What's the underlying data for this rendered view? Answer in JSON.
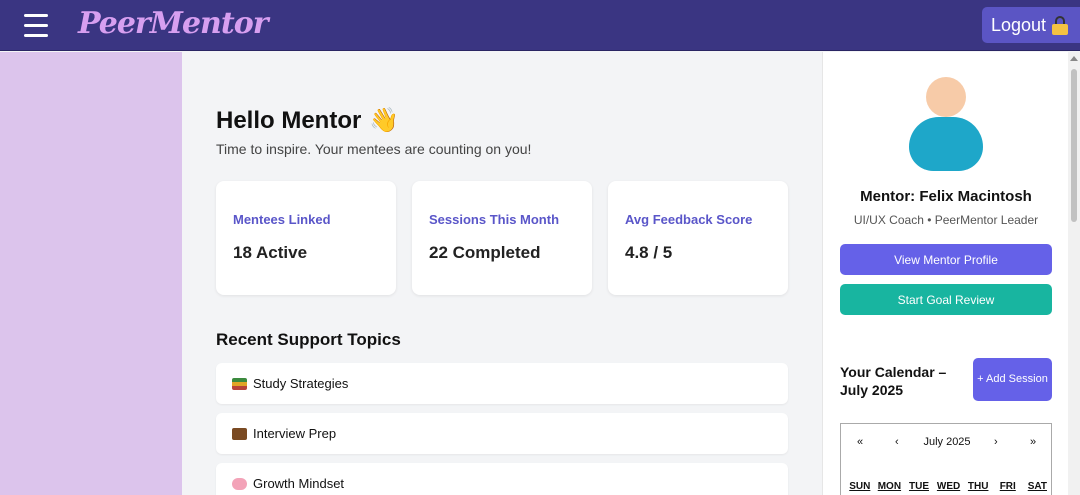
{
  "nav": {
    "brand": "PeerMentor",
    "logout_label": "Logout"
  },
  "main": {
    "greeting": "Hello Mentor",
    "greeting_emoji": "👋",
    "subtitle": "Time to inspire. Your mentees are counting on you!",
    "stats": [
      {
        "label": "Mentees Linked",
        "value": "18 Active"
      },
      {
        "label": "Sessions This Month",
        "value": "22 Completed"
      },
      {
        "label": "Avg Feedback Score",
        "value": "4.8 / 5"
      }
    ],
    "topics_title": "Recent Support Topics",
    "topics": [
      {
        "label": "Study Strategies",
        "icon": "books-icon"
      },
      {
        "label": "Interview Prep",
        "icon": "briefcase-icon"
      },
      {
        "label": "Growth Mindset",
        "icon": "brain-icon"
      }
    ]
  },
  "profile": {
    "name": "Mentor: Felix Macintosh",
    "role": "UI/UX Coach • PeerMentor Leader",
    "view_profile_label": "View Mentor Profile",
    "goal_review_label": "Start Goal Review"
  },
  "calendar": {
    "title": "Your Calendar – July 2025",
    "add_session_label": "+ Add Session",
    "month": "July 2025",
    "nav_prev_year": "«",
    "nav_prev_month": "‹",
    "nav_next_month": "›",
    "nav_next_year": "»",
    "weekdays": [
      "SUN",
      "MON",
      "TUE",
      "WED",
      "THU",
      "FRI",
      "SAT"
    ]
  },
  "colors": {
    "topbar": "#3a3582",
    "brand": "#d79ff0",
    "sidebar": "#dcc4ec",
    "primary": "#6561e8",
    "teal": "#18b5a0",
    "stat_label": "#5a56c9"
  }
}
